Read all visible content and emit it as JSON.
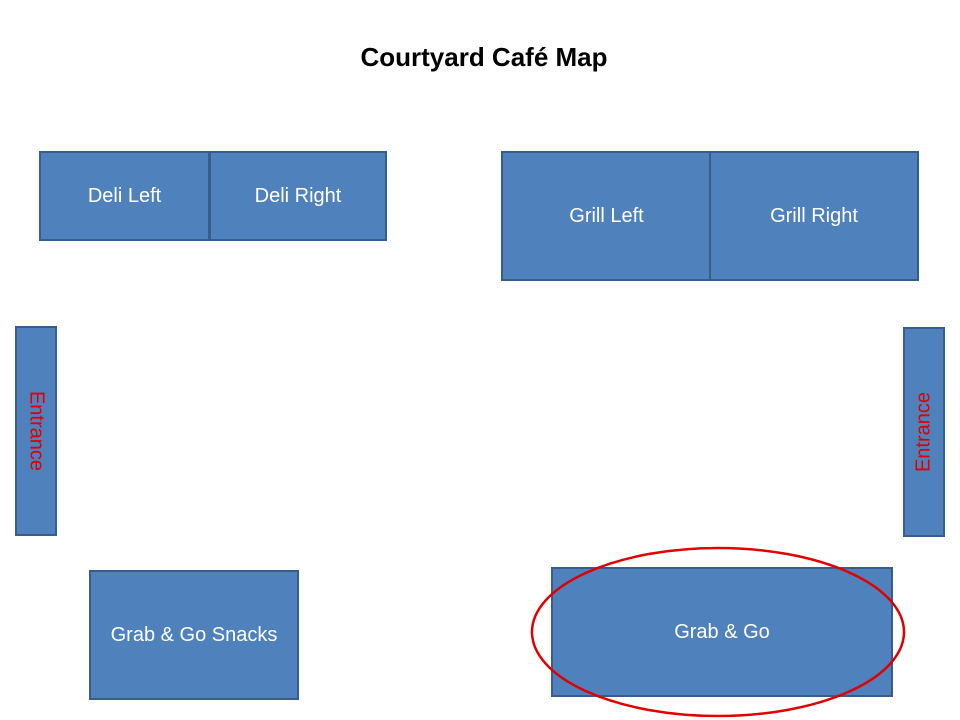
{
  "title": "Courtyard Café Map",
  "colors": {
    "station_fill": "#4f81bd",
    "station_border": "#385d8a",
    "entrance_text": "#e00000",
    "station_text": "#ffffff",
    "highlight": "#e00000"
  },
  "stations": {
    "deli_left": "Deli Left",
    "deli_right": "Deli Right",
    "grill_left": "Grill Left",
    "grill_right": "Grill Right",
    "snacks": "Grab & Go Snacks",
    "grab_go": "Grab & Go"
  },
  "entrances": {
    "left": "Entrance",
    "right": "Entrance"
  },
  "highlighted_station": "Grab & Go"
}
